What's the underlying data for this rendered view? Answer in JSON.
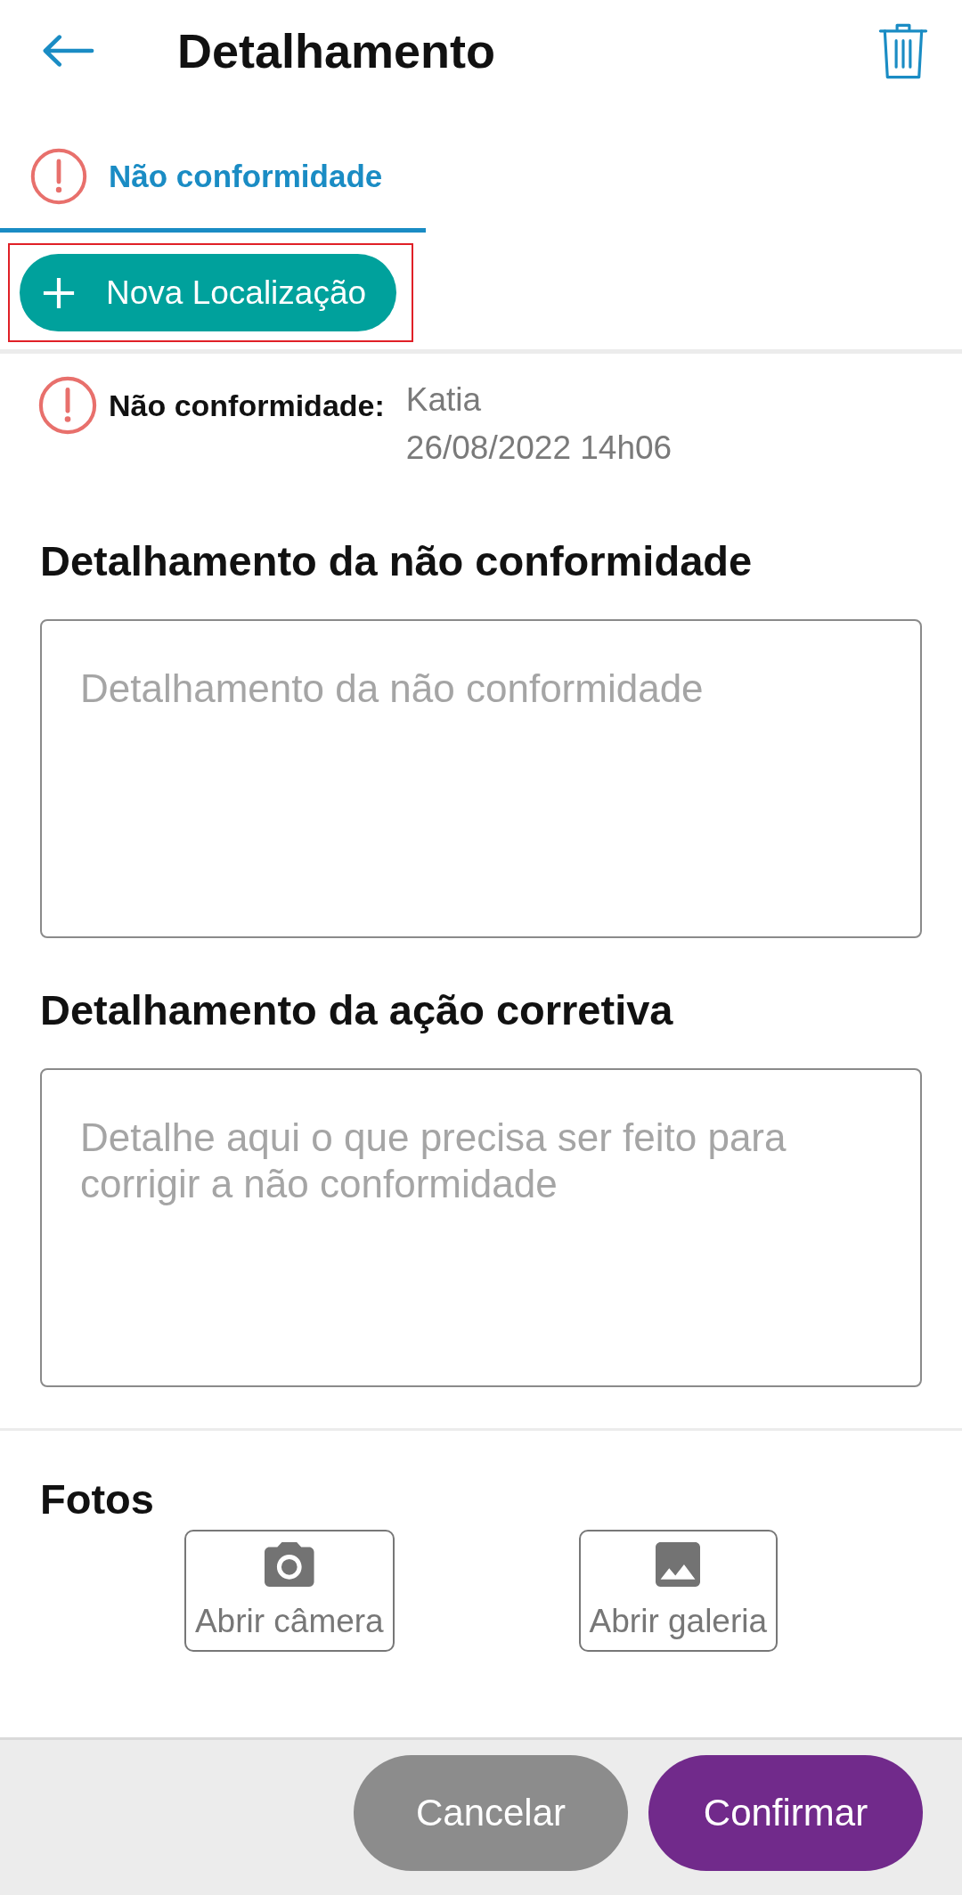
{
  "header": {
    "title": "Detalhamento"
  },
  "tabs": [
    {
      "label": "Não conformidade",
      "selected": true
    }
  ],
  "new_location_button": {
    "label": "Nova Localização",
    "highlighted": true
  },
  "record": {
    "label": "Não conformidade:",
    "author": "Katia",
    "timestamp": "26/08/2022 14h06"
  },
  "sections": [
    {
      "title": "Detalhamento da não conformidade",
      "placeholder": "Detalhamento da não conformidade"
    },
    {
      "title": "Detalhamento da ação corretiva",
      "placeholder": "Detalhe aqui o que precisa ser feito para corrigir a não conformidade"
    }
  ],
  "photos": {
    "title": "Fotos",
    "buttons": [
      {
        "kind": "camera",
        "label": "Abrir câmera"
      },
      {
        "kind": "gallery",
        "label": "Abrir galeria"
      }
    ]
  },
  "actions": [
    {
      "kind": "secondary",
      "label": "Cancelar"
    },
    {
      "kind": "primary",
      "label": "Confirmar"
    }
  ]
}
